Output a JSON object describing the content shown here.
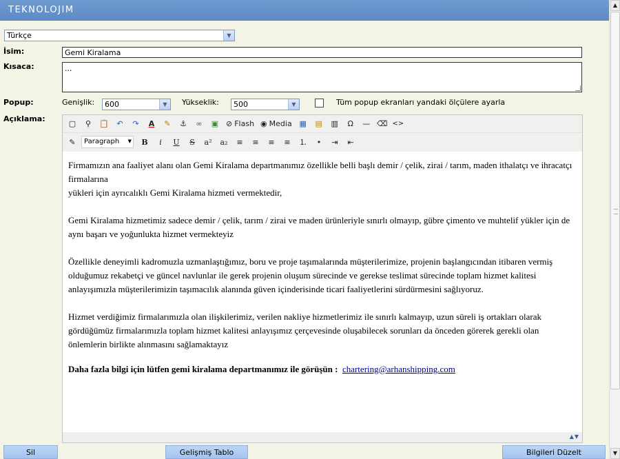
{
  "header": {
    "logo": "TEKNOLOJIM"
  },
  "language": {
    "value": "Türkçe"
  },
  "form": {
    "name_label": "İsim:",
    "name_value": "Gemi Kiralama",
    "summary_label": "Kısaca:",
    "summary_value": "...",
    "popup_label": "Popup:",
    "width_label": "Genişlik:",
    "width_value": "600",
    "height_label": "Yükseklik:",
    "height_value": "500",
    "popup_all_label": "Tüm popup ekranları yandaki ölçülere ayarla",
    "desc_label": "Açıklama:"
  },
  "toolbar": {
    "row1": [
      {
        "name": "new-document-icon",
        "glyph": "▢"
      },
      {
        "name": "find-icon",
        "glyph": "⚲"
      },
      {
        "name": "paste-icon",
        "glyph": "📋"
      },
      {
        "name": "undo-icon",
        "glyph": "↶"
      },
      {
        "name": "redo-icon",
        "glyph": "↷"
      },
      {
        "name": "font-color-icon",
        "glyph": "A"
      },
      {
        "name": "highlight-icon",
        "glyph": "✎"
      },
      {
        "name": "anchor-icon",
        "glyph": "⚓"
      },
      {
        "name": "link-icon",
        "glyph": "∞"
      },
      {
        "name": "image-icon",
        "glyph": "▣"
      }
    ],
    "flash_label": "Flash",
    "media_label": "Media",
    "row1b": [
      {
        "name": "table-icon",
        "glyph": "▦"
      },
      {
        "name": "table-edit-icon",
        "glyph": "▤"
      },
      {
        "name": "form-icon",
        "glyph": "▥"
      },
      {
        "name": "special-char-icon",
        "glyph": "Ω"
      },
      {
        "name": "horizontal-rule-icon",
        "glyph": "—"
      },
      {
        "name": "eraser-icon",
        "glyph": "⌫"
      },
      {
        "name": "source-code-icon",
        "glyph": "<>"
      }
    ],
    "format_value": "Paragraph",
    "row2": [
      {
        "name": "bold-icon",
        "glyph": "B"
      },
      {
        "name": "italic-icon",
        "glyph": "i"
      },
      {
        "name": "underline-icon",
        "glyph": "U"
      },
      {
        "name": "strikethrough-icon",
        "glyph": "S"
      },
      {
        "name": "superscript-icon",
        "glyph": "a²"
      },
      {
        "name": "subscript-icon",
        "glyph": "a₂"
      },
      {
        "name": "align-left-icon",
        "glyph": "≡"
      },
      {
        "name": "align-center-icon",
        "glyph": "≡"
      },
      {
        "name": "align-right-icon",
        "glyph": "≡"
      },
      {
        "name": "align-justify-icon",
        "glyph": "≡"
      },
      {
        "name": "ordered-list-icon",
        "glyph": "⒈"
      },
      {
        "name": "unordered-list-icon",
        "glyph": "•"
      },
      {
        "name": "indent-icon",
        "glyph": "⇥"
      },
      {
        "name": "outdent-icon",
        "glyph": "⇤"
      }
    ]
  },
  "content": {
    "p1_l1": "Firmamızın ana faaliyet alanı olan Gemi Kiralama departmanımız özellikle belli başlı demir / çelik, zirai / tarım, maden ithalatçı ve ihracatçı firmalarına",
    "p1_l2": "yükleri için ayrıcalıklı Gemi Kiralama hizmeti vermektedir,",
    "p2": "Gemi Kiralama hizmetimiz sadece demir / çelik, tarım / zirai ve maden ürünleriyle sınırlı olmayıp, gübre çimento ve muhtelif yükler için de aynı başarı ve yoğunlukta hizmet vermekteyiz",
    "p3": "Özellikle deneyimli kadromuzla uzmanlaştığımız, boru ve proje taşımalarında müşterilerimize, projenin başlangıcından itibaren vermiş olduğumuz rekabetçi ve güncel navlunlar ile gerek projenin oluşum sürecinde ve gerekse teslimat sürecinde toplam hizmet kalitesi anlayışımızla müşterilerimizin taşımacılık alanında güven içinderisinde ticari faaliyetlerini sürdürmesini sağlıyoruz.",
    "p4": "Hizmet verdiğimiz firmalarımızla olan ilişkilerimiz, verilen nakliye hizmetlerimiz ile sınırlı kalmayıp, uzun süreli iş ortakları olarak gördüğümüz firmalarımızla toplam hizmet kalitesi anlayışımız çerçevesinde oluşabilecek sorunları da önceden görerek gerekli olan önlemlerin birlikte alınmasını sağlamaktayız",
    "p5_bold": "Daha fazla bilgi için lütfen gemi kiralama departmanımız ile görüşün :",
    "p5_link": "chartering@arhanshipping.com"
  },
  "buttons": {
    "delete": "Sil",
    "advanced_table": "Gelişmiş Tablo",
    "edit_info": "Bilgileri Düzelt"
  }
}
